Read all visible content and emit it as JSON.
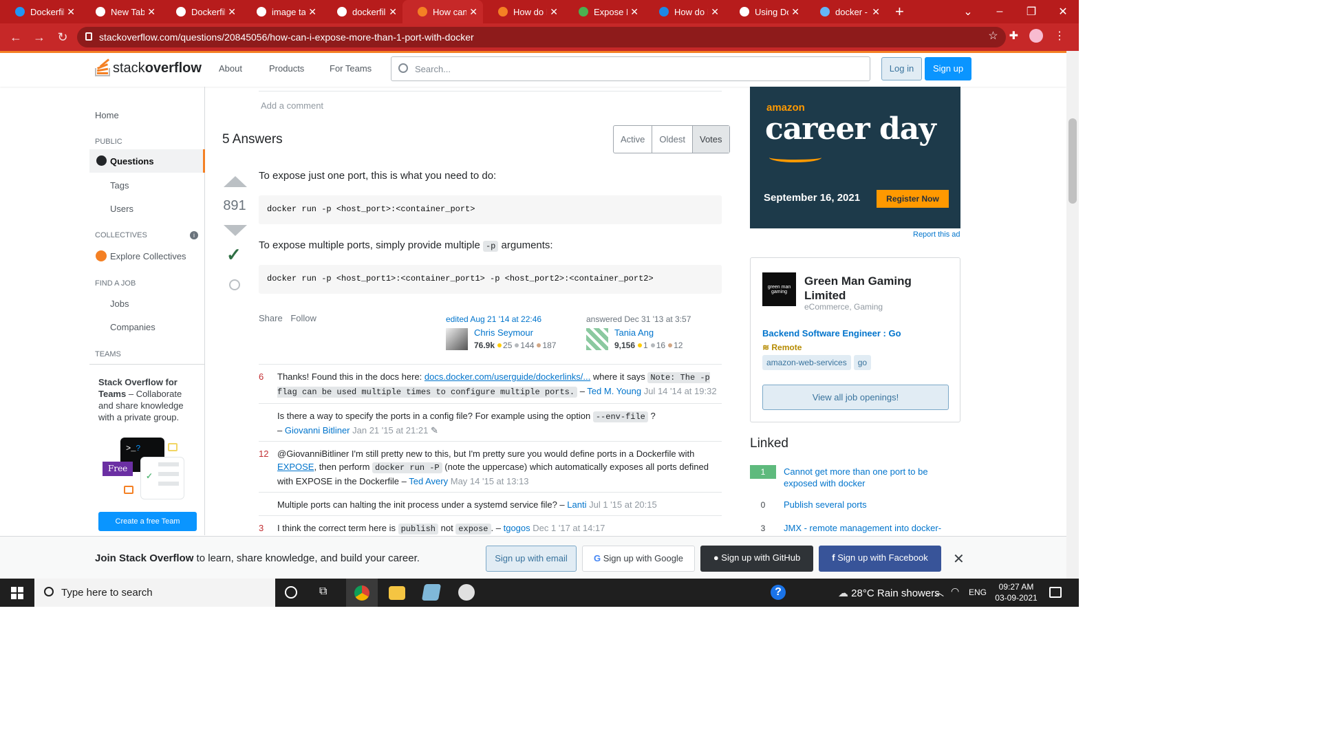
{
  "browser": {
    "tabs": [
      {
        "label": "Dockerfile",
        "icon": "docker-icon",
        "color": "#2196f3"
      },
      {
        "label": "New Tab",
        "icon": "chrome-icon",
        "color": "#ffffff"
      },
      {
        "label": "Dockerfile",
        "icon": "google-icon",
        "color": "#ffffff"
      },
      {
        "label": "image tag",
        "icon": "google-icon",
        "color": "#ffffff"
      },
      {
        "label": "dockerfile",
        "icon": "google-icon",
        "color": "#ffffff"
      },
      {
        "label": "How can",
        "icon": "stackoverflow-icon",
        "color": "#f48024",
        "active": true
      },
      {
        "label": "How do I",
        "icon": "stackoverflow-icon",
        "color": "#f48024"
      },
      {
        "label": "Expose M",
        "icon": "document-icon",
        "color": "#4caf50"
      },
      {
        "label": "How do I",
        "icon": "edge-icon",
        "color": "#1e88e5"
      },
      {
        "label": "Using Do",
        "icon": "globe-icon",
        "color": "#ffffff"
      },
      {
        "label": "docker - V",
        "icon": "bing-icon",
        "color": "#64b5f6"
      }
    ],
    "new_tab": "+",
    "url": "stackoverflow.com/questions/20845056/how-can-i-expose-more-than-1-port-with-docker"
  },
  "header": {
    "logo_light": "stack",
    "logo_bold": "overflow",
    "nav": [
      "About",
      "Products",
      "For Teams"
    ],
    "search_placeholder": "Search...",
    "login": "Log in",
    "signup": "Sign up"
  },
  "left_nav": {
    "home": "Home",
    "public": "PUBLIC",
    "questions": "Questions",
    "tags": "Tags",
    "users": "Users",
    "collectives": "COLLECTIVES",
    "explore_collectives": "Explore Collectives",
    "find_a_job": "FIND A JOB",
    "jobs": "Jobs",
    "companies": "Companies",
    "teams": "TEAMS",
    "teams_title": "Stack Overflow for Teams",
    "teams_desc": " – Collaborate and share knowledge with a private group.",
    "free_badge": "Free",
    "create_team": "Create a free Team"
  },
  "main": {
    "add_comment": "Add a comment",
    "answers_title": "5 Answers",
    "sort_tabs": [
      "Active",
      "Oldest",
      "Votes"
    ],
    "answer": {
      "votes": "891",
      "p1": "To expose just one port, this is what you need to do:",
      "code1": "docker run -p <host_port>:<container_port>",
      "p2_before": "To expose multiple ports, simply provide multiple ",
      "p2_code": "-p",
      "p2_after": " arguments:",
      "code2": "docker run -p <host_port1>:<container_port1> -p <host_port2>:<container_port2>",
      "share": "Share",
      "follow": "Follow",
      "edited": "edited Aug 21 '14 at 22:46",
      "editor": {
        "name": "Chris Seymour",
        "rep": "76.9k",
        "gold": "25",
        "silver": "144",
        "bronze": "187"
      },
      "answered": "answered Dec 31 '13 at 3:57",
      "author": {
        "name": "Tania Ang",
        "rep": "9,156",
        "gold": "1",
        "silver": "16",
        "bronze": "12"
      }
    },
    "comments": [
      {
        "score": "6",
        "text_before": "Thanks! Found this in the docs here: ",
        "link": "docs.docker.com/userguide/dockerlinks/...",
        "text_mid": " where it says ",
        "code": "Note: The -p flag can be used multiple times to configure multiple ports.",
        "user": "Ted M. Young",
        "when": "Jul 14 '14 at 19:32"
      },
      {
        "score": "",
        "text_before": "Is there a way to specify the ports in a config file? For example using the option ",
        "code": "--env-file",
        "text_after": " ?",
        "user": "Giovanni Bitliner",
        "when": "Jan 21 '15 at 21:21"
      },
      {
        "score": "12",
        "text_before": "@GiovanniBitliner I'm still pretty new to this, but I'm pretty sure you would define ports in a Dockerfile with ",
        "link": "EXPOSE",
        "text_mid": ", then perform ",
        "code": "docker run -P",
        "text_after": " (note the uppercase) which automatically exposes all ports defined with EXPOSE in the Dockerfile",
        "user": "Ted Avery",
        "when": "May 14 '15 at 13:13"
      },
      {
        "score": "",
        "text_before": "Multiple ports can halting the init process under a systemd service file?",
        "user": "Lanti",
        "when": "Jul 1 '15 at 20:15"
      },
      {
        "score": "3",
        "text_before": "I think the correct term here is ",
        "code": "publish",
        "text_mid": " not ",
        "code2": "expose",
        "text_after": ".",
        "user": "tgogos",
        "when": "Dec 1 '17 at 14:17"
      }
    ]
  },
  "sidebar": {
    "ad": {
      "brand": "amazon",
      "headline": "career day",
      "date": "September 16, 2021",
      "cta": "Register Now"
    },
    "report_ad": "Report this ad",
    "job": {
      "company": "Green Man Gaming Limited",
      "logo_text": "green man gaming",
      "company_tags": "eCommerce, Gaming",
      "title": "Backend Software Engineer : Go",
      "remote": "Remote",
      "tags": [
        "amazon-web-services",
        "go"
      ],
      "view_all": "View all job openings!"
    },
    "linked_title": "Linked",
    "linked": [
      {
        "count": "1",
        "accepted": true,
        "title": "Cannot get more than one port to be exposed with docker"
      },
      {
        "count": "0",
        "accepted": false,
        "title": "Publish several ports"
      },
      {
        "count": "3",
        "accepted": false,
        "title": "JMX - remote management into docker-"
      }
    ]
  },
  "join_banner": {
    "bold": "Join Stack Overflow",
    "rest": " to learn, share knowledge, and build your career.",
    "email": "Sign up with email",
    "google": "Sign up with Google",
    "github": "Sign up with GitHub",
    "facebook": "Sign up with Facebook"
  },
  "taskbar": {
    "search": "Type here to search",
    "weather": "28°C  Rain showers",
    "lang": "ENG",
    "time": "09:27 AM",
    "date": "03-09-2021"
  },
  "colors": {
    "accent": "#f48024",
    "link": "#0074cc",
    "browser_red": "#c62828",
    "accepted": "#5eba7d"
  }
}
